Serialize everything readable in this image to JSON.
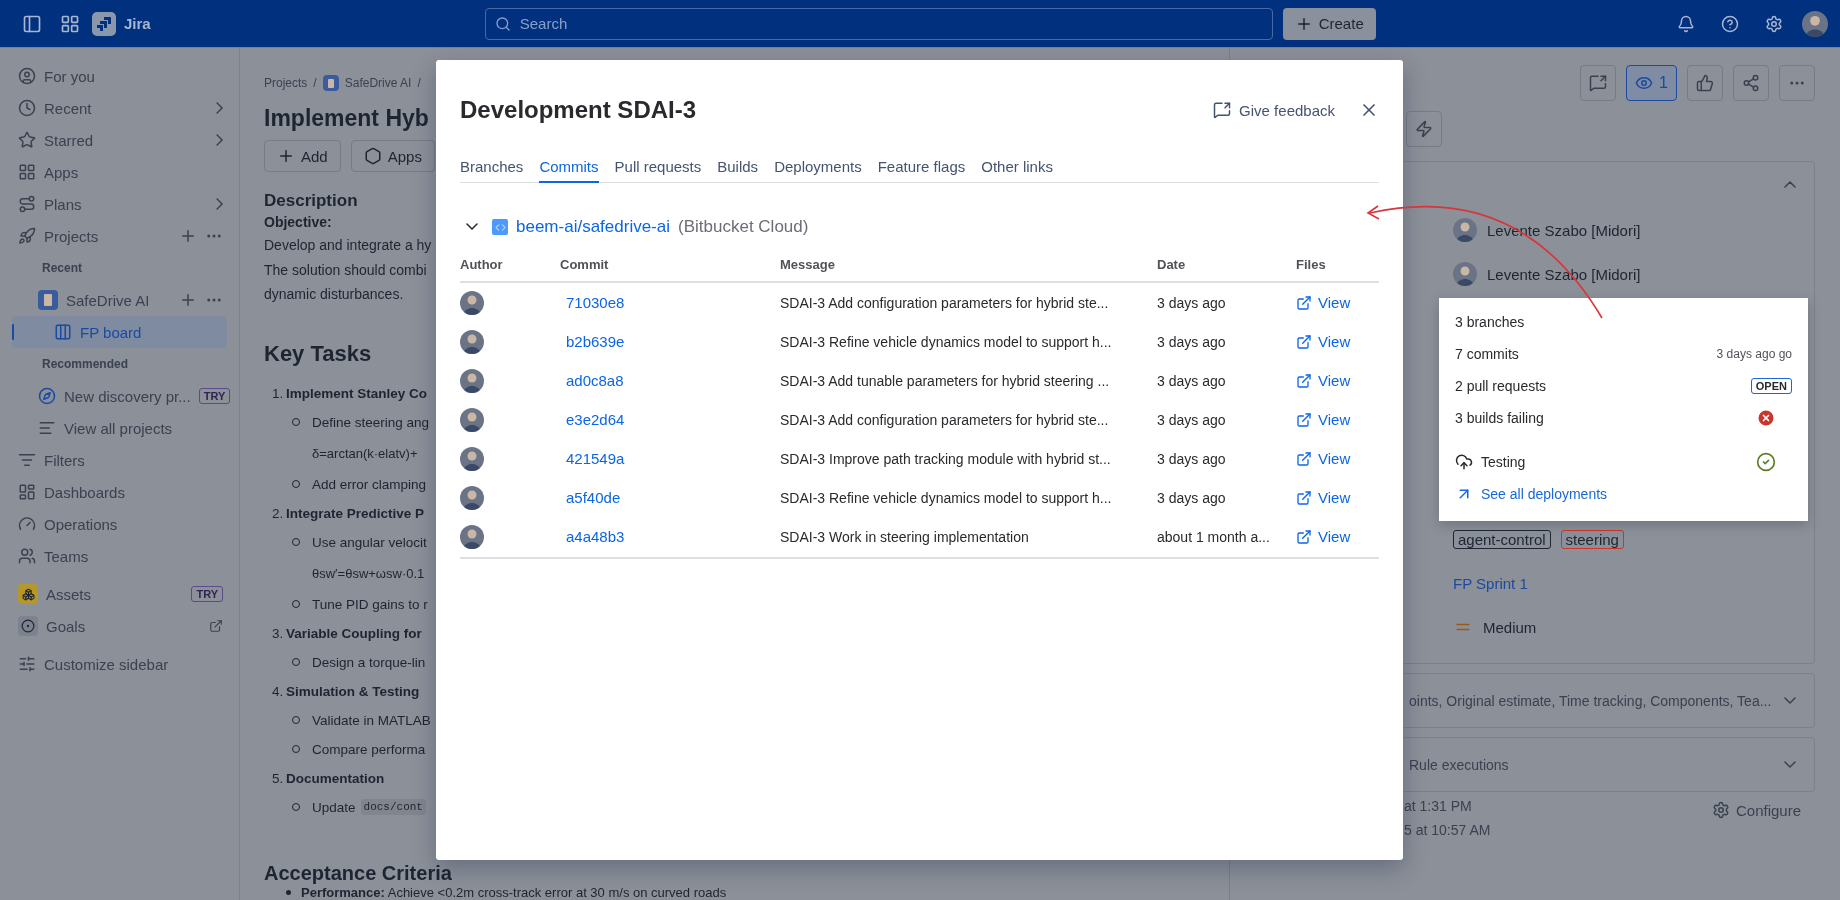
{
  "topbar": {
    "product": "Jira",
    "search": {
      "placeholder": "Search"
    },
    "create": "Create"
  },
  "sidebar": {
    "items": [
      {
        "kind": "nav",
        "label": "For you",
        "submenu": false,
        "selected": false
      },
      {
        "kind": "nav",
        "label": "Recent",
        "submenu": true,
        "selected": false
      },
      {
        "kind": "nav",
        "label": "Starred",
        "submenu": true,
        "selected": false
      },
      {
        "kind": "nav",
        "label": "Apps",
        "submenu": false,
        "selected": false
      },
      {
        "kind": "nav",
        "label": "Plans",
        "submenu": true,
        "selected": false
      },
      {
        "kind": "nav",
        "label": "Projects",
        "submenu": false,
        "actions": true,
        "selected": false
      },
      {
        "kind": "heading",
        "label": "Recent"
      },
      {
        "kind": "project",
        "label": "SafeDrive AI",
        "actions": true,
        "selected": false
      },
      {
        "kind": "board",
        "label": "FP board",
        "selected": true
      },
      {
        "kind": "heading",
        "label": "Recommended"
      },
      {
        "kind": "sub",
        "label": "New discovery pr...",
        "badge": "TRY",
        "selected": false
      },
      {
        "kind": "sub",
        "label": "View all projects",
        "selected": false
      },
      {
        "kind": "nav",
        "label": "Filters",
        "submenu": false,
        "selected": false
      },
      {
        "kind": "nav",
        "label": "Dashboards",
        "submenu": false,
        "selected": false
      },
      {
        "kind": "nav",
        "label": "Operations",
        "submenu": false,
        "selected": false
      },
      {
        "kind": "nav",
        "label": "Teams",
        "submenu": false,
        "selected": false
      },
      {
        "kind": "app",
        "label": "Assets",
        "badge": "TRY",
        "selected": false
      },
      {
        "kind": "app",
        "label": "Goals",
        "external": true,
        "selected": false
      },
      {
        "kind": "footer",
        "label": "Customize sidebar",
        "selected": false
      }
    ]
  },
  "issue": {
    "breadcrumbs": [
      {
        "kind": "text",
        "text": "Projects"
      },
      {
        "kind": "project",
        "text": "SafeDrive AI"
      }
    ],
    "separator": "/",
    "title": "Implement Hyb",
    "actions": [
      "Add",
      "Apps"
    ],
    "description": {
      "heading": "Description",
      "label": "Objective:",
      "lines": [
        "Develop and integrate a hy",
        "The solution should combi",
        "dynamic disturbances."
      ]
    },
    "key_tasks": {
      "heading": "Key Tasks",
      "items": [
        {
          "number": "1.",
          "label": "Implement Stanley Co",
          "children": [
            {
              "kind": "bullet",
              "text": "Define steering ang"
            },
            {
              "kind": "formula",
              "text": "δ=arctan(k·elatv)+"
            },
            {
              "kind": "bullet",
              "text": "Add error clamping"
            }
          ]
        },
        {
          "number": "2.",
          "label": "Integrate Predictive P",
          "children": [
            {
              "kind": "bullet",
              "text": "Use angular velocit"
            },
            {
              "kind": "formula",
              "text": "θsw′=θsw+ωsw·0.1"
            },
            {
              "kind": "bullet",
              "text": "Tune PID gains to r"
            }
          ]
        },
        {
          "number": "3.",
          "label": "Variable Coupling for",
          "children": [
            {
              "kind": "bullet",
              "text": "Design a torque-lin"
            }
          ]
        },
        {
          "number": "4.",
          "label": "Simulation & Testing",
          "children": [
            {
              "kind": "bullet",
              "text": "Validate in MATLAB"
            },
            {
              "kind": "bullet",
              "text": "Compare performa"
            }
          ]
        },
        {
          "number": "5.",
          "label": "Documentation",
          "children": [
            {
              "kind": "bullet",
              "text": "Update",
              "code": "docs/cont"
            }
          ]
        }
      ]
    },
    "acceptance": {
      "heading": "Acceptance Criteria",
      "items": [
        {
          "label": "Performance:",
          "text": "Achieve <0.2m cross-track error at 30 m/s on curved roads"
        }
      ]
    }
  },
  "side_panel": {
    "watchers": "1",
    "watching": true,
    "fields": [
      {
        "kind": "person",
        "value": "Levente Szabo [Midori]"
      },
      {
        "kind": "person",
        "value": "Levente Szabo [Midori]"
      },
      {
        "kind": "labels",
        "labels": [
          {
            "text": "agent-control",
            "color": "#1f2633"
          },
          {
            "text": "steering",
            "color": "#c9372c"
          }
        ]
      },
      {
        "kind": "link",
        "value": "FP Sprint 1"
      },
      {
        "kind": "priority",
        "value": "Medium"
      }
    ],
    "sections": [
      {
        "title": "oints, Original estimate, Time tracking, Components, Tea..."
      },
      {
        "title": "Rule executions"
      }
    ],
    "timestamps": [
      "at 1:31 PM",
      "5 at 10:57 AM"
    ],
    "configure": "Configure"
  },
  "dev_summary": {
    "rows": [
      {
        "kind": "branches",
        "text": "3 branches"
      },
      {
        "kind": "commits",
        "text": "7 commits",
        "meta": "3 days ago go"
      },
      {
        "kind": "pulls",
        "text": "2 pull requests",
        "badge": "OPEN"
      },
      {
        "kind": "builds",
        "text": "3 builds failing",
        "success": false
      },
      {
        "kind": "deployment",
        "text": "Testing",
        "success": true
      }
    ],
    "link": "See all deployments"
  },
  "modal": {
    "title": "Development SDAI-3",
    "feedback": "Give feedback",
    "tabs": [
      {
        "label": "Branches",
        "selected": false
      },
      {
        "label": "Commits",
        "selected": true
      },
      {
        "label": "Pull requests",
        "selected": false
      },
      {
        "label": "Builds",
        "selected": false
      },
      {
        "label": "Deployments",
        "selected": false
      },
      {
        "label": "Feature flags",
        "selected": false
      },
      {
        "label": "Other links",
        "selected": false
      }
    ],
    "repository": {
      "name": "beem-ai/safedrive-ai",
      "host": "(Bitbucket Cloud)",
      "expanded": true
    },
    "columns": [
      "Author",
      "Commit",
      "Message",
      "Date",
      "Files"
    ],
    "commits": [
      {
        "hash": "71030e8",
        "message": "SDAI-3 Add configuration parameters for hybrid ste...",
        "date": "3 days ago",
        "files": "View"
      },
      {
        "hash": "b2b639e",
        "message": "SDAI-3 Refine vehicle dynamics model to support h...",
        "date": "3 days ago",
        "files": "View"
      },
      {
        "hash": "ad0c8a8",
        "message": "SDAI-3 Add tunable parameters for hybrid steering ...",
        "date": "3 days ago",
        "files": "View"
      },
      {
        "hash": "e3e2d64",
        "message": "SDAI-3 Add configuration parameters for hybrid ste...",
        "date": "3 days ago",
        "files": "View"
      },
      {
        "hash": "421549a",
        "message": "SDAI-3 Improve path tracking module with hybrid st...",
        "date": "3 days ago",
        "files": "View"
      },
      {
        "hash": "a5f40de",
        "message": "SDAI-3 Refine vehicle dynamics model to support h...",
        "date": "3 days ago",
        "files": "View"
      },
      {
        "hash": "a4a48b3",
        "message": "SDAI-3 Work in steering implementation",
        "date": "about 1 month a...",
        "files": "View"
      }
    ]
  }
}
